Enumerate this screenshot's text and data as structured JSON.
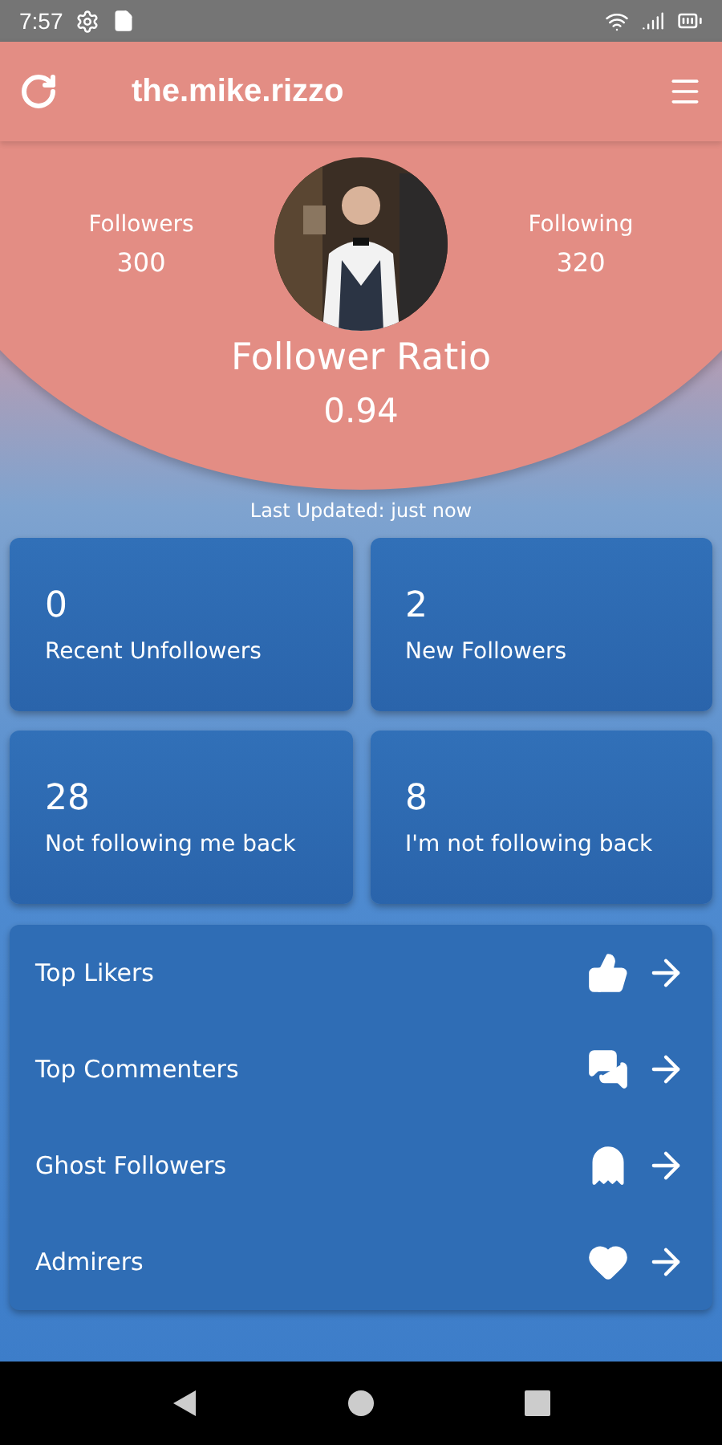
{
  "status_bar": {
    "time": "7:57"
  },
  "header": {
    "title": "the.mike.rizzo"
  },
  "profile": {
    "followers_label": "Followers",
    "followers": "300",
    "following_label": "Following",
    "following": "320",
    "ratio_label": "Follower Ratio",
    "ratio": "0.94"
  },
  "last_updated": "Last Updated: just now",
  "stats": [
    {
      "value": "0",
      "label": "Recent Unfollowers"
    },
    {
      "value": "2",
      "label": "New Followers"
    },
    {
      "value": "28",
      "label": "Not following me back"
    },
    {
      "value": "8",
      "label": "I'm not following back"
    }
  ],
  "links": [
    {
      "label": "Top Likers",
      "kind": "likes"
    },
    {
      "label": "Top Commenters",
      "kind": "comments"
    },
    {
      "label": "Ghost Followers",
      "kind": "ghost"
    },
    {
      "label": "Admirers",
      "kind": "heart"
    }
  ]
}
